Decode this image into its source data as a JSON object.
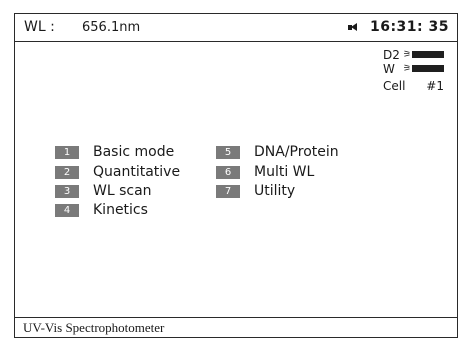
{
  "header": {
    "wl_label": "WL :",
    "wl_value": "656.1nm",
    "time": "16:31: 35",
    "icon": "speaker-icon"
  },
  "lamps": {
    "d2_label": "D2",
    "w_label": "W",
    "indicator": "⚞",
    "cell_label": "Cell",
    "cell_value": "#1"
  },
  "menu": {
    "left": [
      {
        "num": "1",
        "label": "Basic mode"
      },
      {
        "num": "2",
        "label": "Quantitative"
      },
      {
        "num": "3",
        "label": "WL scan"
      },
      {
        "num": "4",
        "label": "Kinetics"
      }
    ],
    "right": [
      {
        "num": "5",
        "label": "DNA/Protein"
      },
      {
        "num": "6",
        "label": "Multi WL"
      },
      {
        "num": "7",
        "label": "Utility"
      }
    ]
  },
  "status": {
    "text": "UV-Vis Spectrophotometer"
  },
  "colors": {
    "badge": "#7a7a7a",
    "border": "#2a2a2a"
  }
}
